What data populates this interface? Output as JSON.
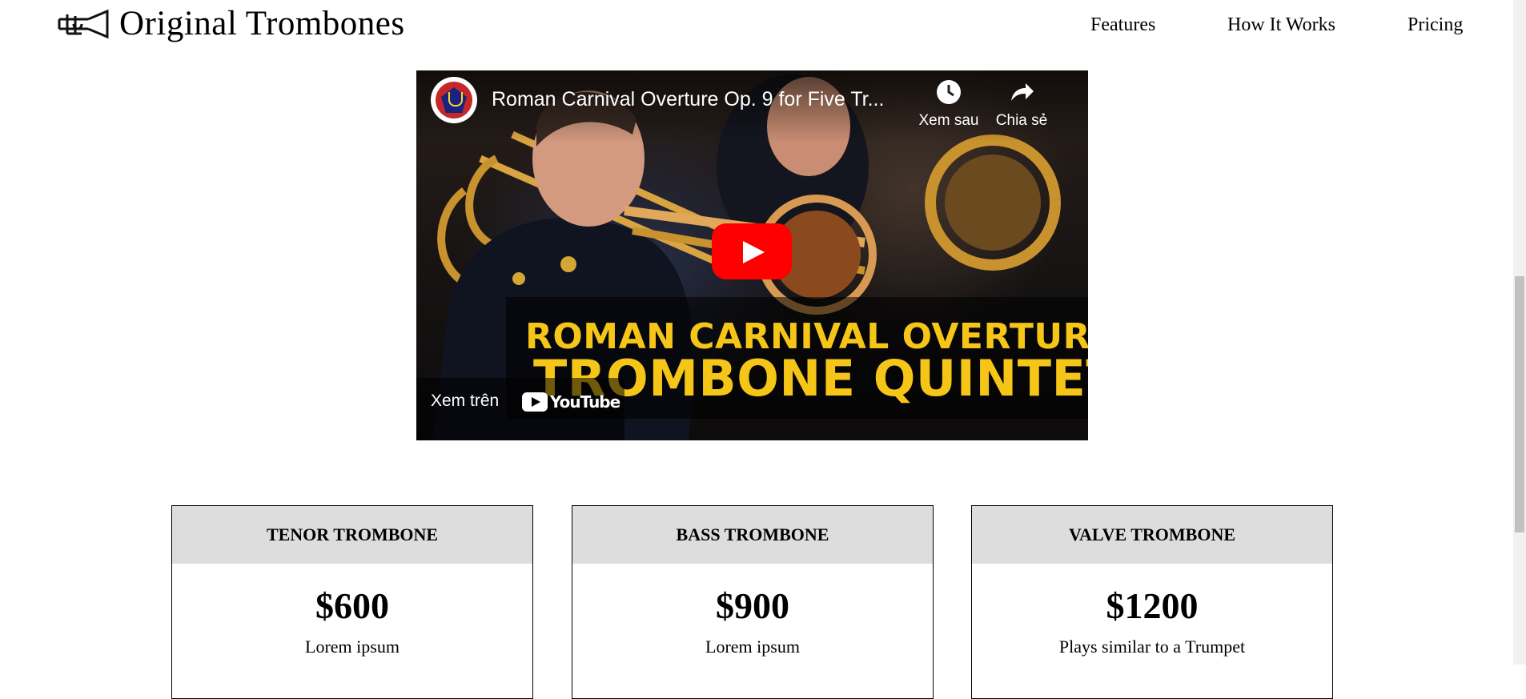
{
  "header": {
    "brand": "Original Trombones",
    "logo_icon": "trombone-logo-icon",
    "nav": [
      "Features",
      "How It Works",
      "Pricing"
    ]
  },
  "video": {
    "title": "Roman Carnival Overture Op. 9 for Five Tr...",
    "watch_later": "Xem sau",
    "share": "Chia sẻ",
    "caption_line1": "ROMAN CARNIVAL OVERTURE",
    "caption_line2": "TROMBONE QUINTET",
    "watch_on": "Xem trên",
    "youtube_word": "YouTube"
  },
  "pricing": [
    {
      "name": "TENOR TROMBONE",
      "price": "$600",
      "desc": "Lorem ipsum"
    },
    {
      "name": "BASS TROMBONE",
      "price": "$900",
      "desc": "Lorem ipsum"
    },
    {
      "name": "VALVE TROMBONE",
      "price": "$1200",
      "desc": "Plays similar to a Trumpet"
    }
  ],
  "colors": {
    "caption": "#f5c518",
    "play": "#ff0000",
    "card_head": "#dddddd"
  }
}
